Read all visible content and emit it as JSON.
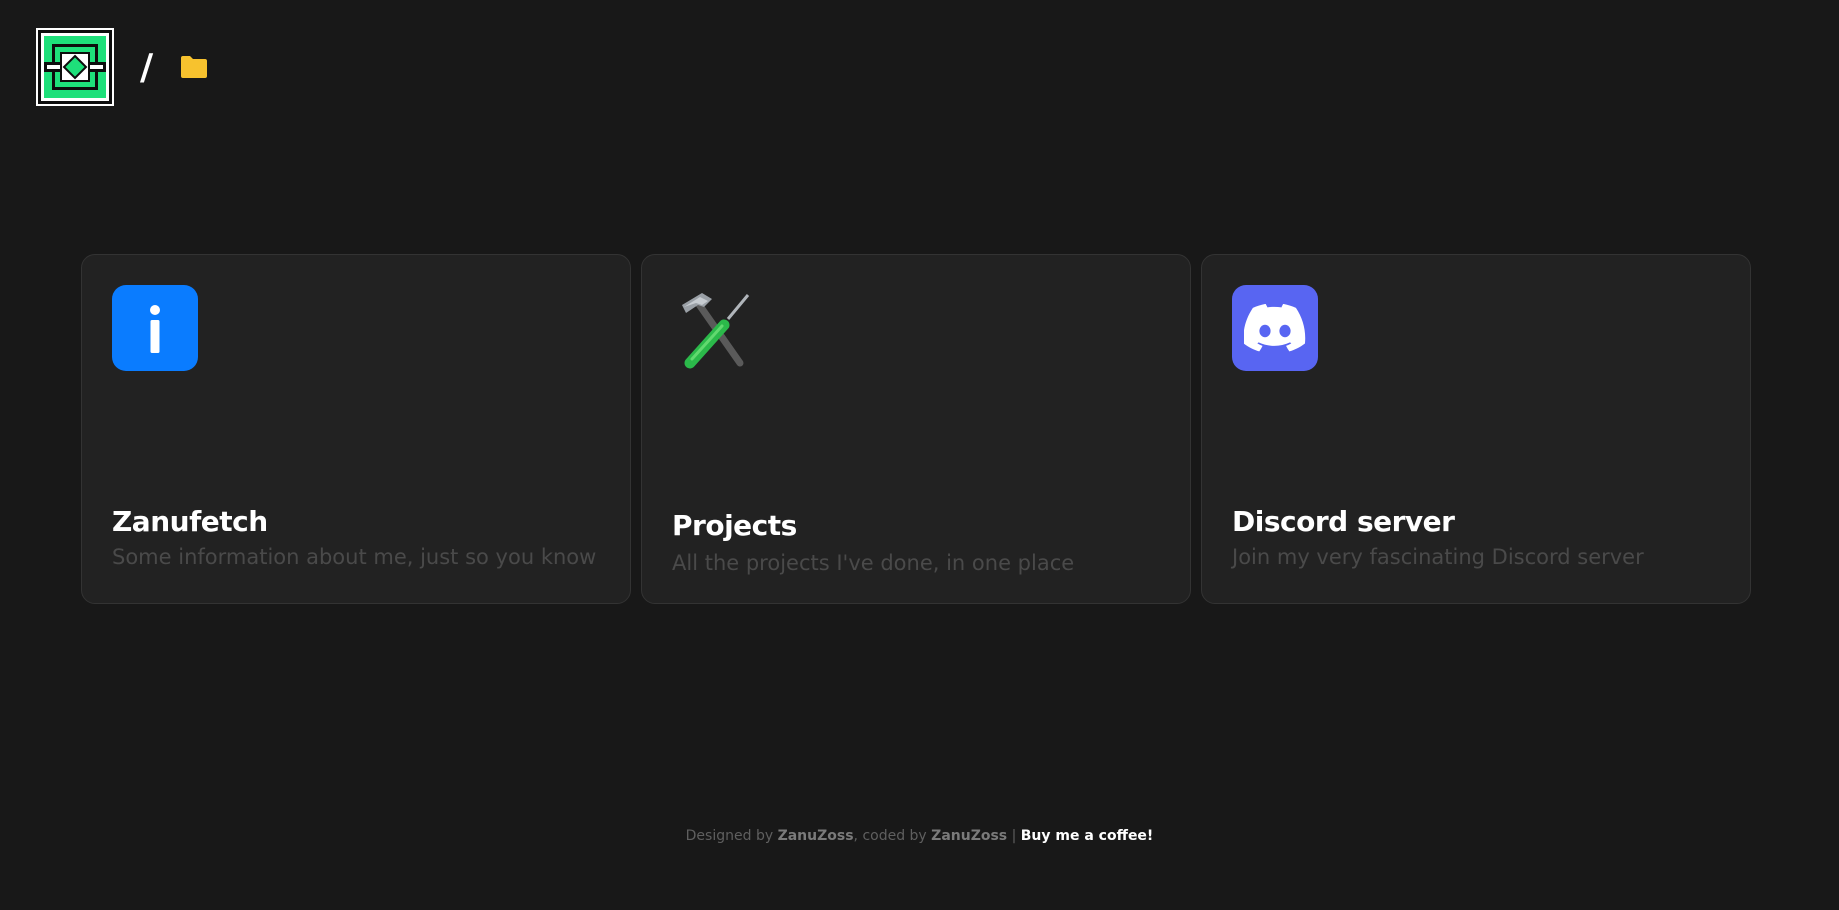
{
  "header": {
    "separator": "/",
    "logo_icon": "maze-diamond-logo",
    "folder_icon": "folder-icon",
    "colors": {
      "logo_green": "#1ee07a",
      "folder": "#f7c22e"
    }
  },
  "cards": [
    {
      "title": "Zanufetch",
      "description": "Some information about me, just so you know",
      "icon": "info-icon",
      "icon_color": "#0a7cff"
    },
    {
      "title": "Projects",
      "description": "All the projects I've done, in one place",
      "icon": "hammer-and-wrench-icon"
    },
    {
      "title": "Discord server",
      "description": "Join my very fascinating Discord server",
      "icon": "discord-icon",
      "icon_color": "#5865f2"
    }
  ],
  "footer": {
    "designed_by_label": "Designed by ",
    "designer": "ZanuZoss",
    "coded_by_label": ", coded by ",
    "coder": "ZanuZoss",
    "divider": " | ",
    "coffee_link": "Buy me a coffee!"
  }
}
